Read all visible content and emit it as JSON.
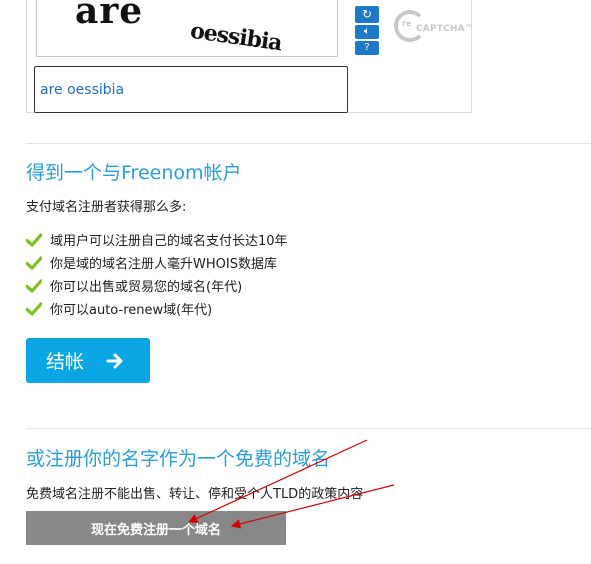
{
  "captcha": {
    "image_words": [
      "are",
      "oessibia"
    ],
    "input_value": "are oessibia",
    "logo_text": "reCAPTCHA™",
    "buttons": [
      "refresh-icon",
      "audio-icon",
      "help-icon"
    ]
  },
  "account_section": {
    "title": "得到一个与Freenom帐户",
    "description": "支付域名注册者获得那么多:",
    "benefits": [
      "域用户可以注册自己的域名支付长达10年",
      "你是域的域名注册人毫升WHOIS数据库",
      "你可以出售或贸易您的域名(年代)",
      "你可以auto-renew域(年代)"
    ],
    "checkout_label": "结帐"
  },
  "free_section": {
    "title": "或注册你的名字作为一个免费的域名",
    "description": "免费域名注册不能出售、转让、停和受个人TLD的政策内容",
    "button_label": "现在免费注册一个域名"
  },
  "colors": {
    "accent_blue": "#2a9ed8",
    "checkout_button": "#0aa6e4",
    "free_button": "#888888",
    "check_green": "#7dc21e",
    "annotation_red": "#d40000"
  }
}
